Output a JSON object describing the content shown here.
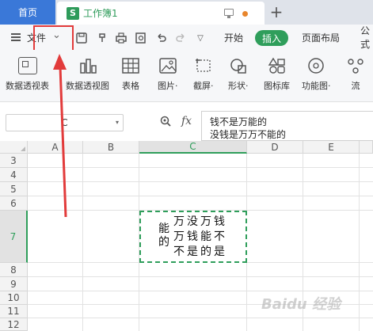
{
  "titlebar": {
    "home_tab": "首页",
    "doc_icon": "S",
    "doc_title": "工作簿1",
    "new_tab": "+"
  },
  "menubar": {
    "file_label": "文件",
    "file_arrow": "⌄",
    "tabs": [
      "开始",
      "插入",
      "页面布局",
      "公式"
    ],
    "active_tab": "插入"
  },
  "ribbon": {
    "items": [
      {
        "label": "数据透视表",
        "icon": "pivot-table-icon"
      },
      {
        "label": "数据透视图",
        "icon": "pivot-chart-icon"
      },
      {
        "label": "表格",
        "icon": "table-icon"
      },
      {
        "label": "图片·",
        "icon": "picture-icon"
      },
      {
        "label": "截屏·",
        "icon": "screenshot-icon"
      },
      {
        "label": "形状·",
        "icon": "shape-icon"
      },
      {
        "label": "图标库",
        "icon": "icon-library-icon"
      },
      {
        "label": "功能图·",
        "icon": "function-chart-icon"
      },
      {
        "label": "流",
        "icon": "flowchart-icon"
      }
    ]
  },
  "formula_bar": {
    "name_box": "C",
    "fx": "fx",
    "content_line1": "钱不是万能的",
    "content_line2": "没钱是万万不能的"
  },
  "grid": {
    "columns": [
      "A",
      "B",
      "C",
      "D",
      "E"
    ],
    "active_column": "C",
    "rows": [
      "3",
      "4",
      "5",
      "6",
      "7",
      "8",
      "9",
      "10",
      "11",
      "12"
    ],
    "active_row": "7",
    "cell_c7": {
      "vertical_col": "能的",
      "line1": "万没万钱",
      "line2": "万钱能不",
      "line3": "不是的是"
    }
  },
  "watermark": "Baidu 经验",
  "colors": {
    "accent": "#2f9e5b",
    "home_tab": "#3a78d8",
    "highlight": "#e23b3b"
  }
}
